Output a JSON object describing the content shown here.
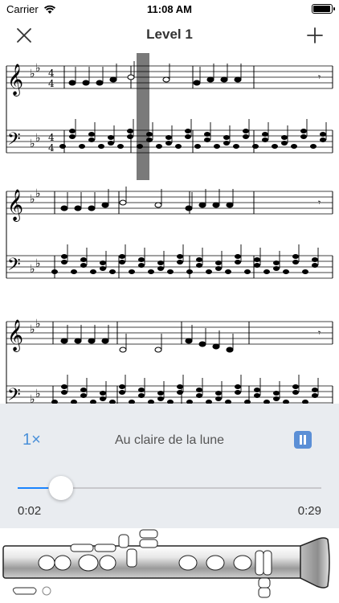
{
  "status_bar": {
    "carrier": "Carrier",
    "time": "11:08 AM",
    "battery_level": 1.0
  },
  "nav": {
    "title": "Level 1",
    "close_icon": "close-icon",
    "add_icon": "plus-icon"
  },
  "score": {
    "key_signature": "B-flat major (2 flats)",
    "time_signature": "4/4"
  },
  "player": {
    "speed": "1×",
    "song_title": "Au claire de la lune",
    "pause_icon": "pause-icon",
    "elapsed": "0:02",
    "total": "0:29",
    "progress": 0.1,
    "accent_color": "#1a84ff"
  },
  "instrument": {
    "name_icon": "clarinet-icon"
  }
}
